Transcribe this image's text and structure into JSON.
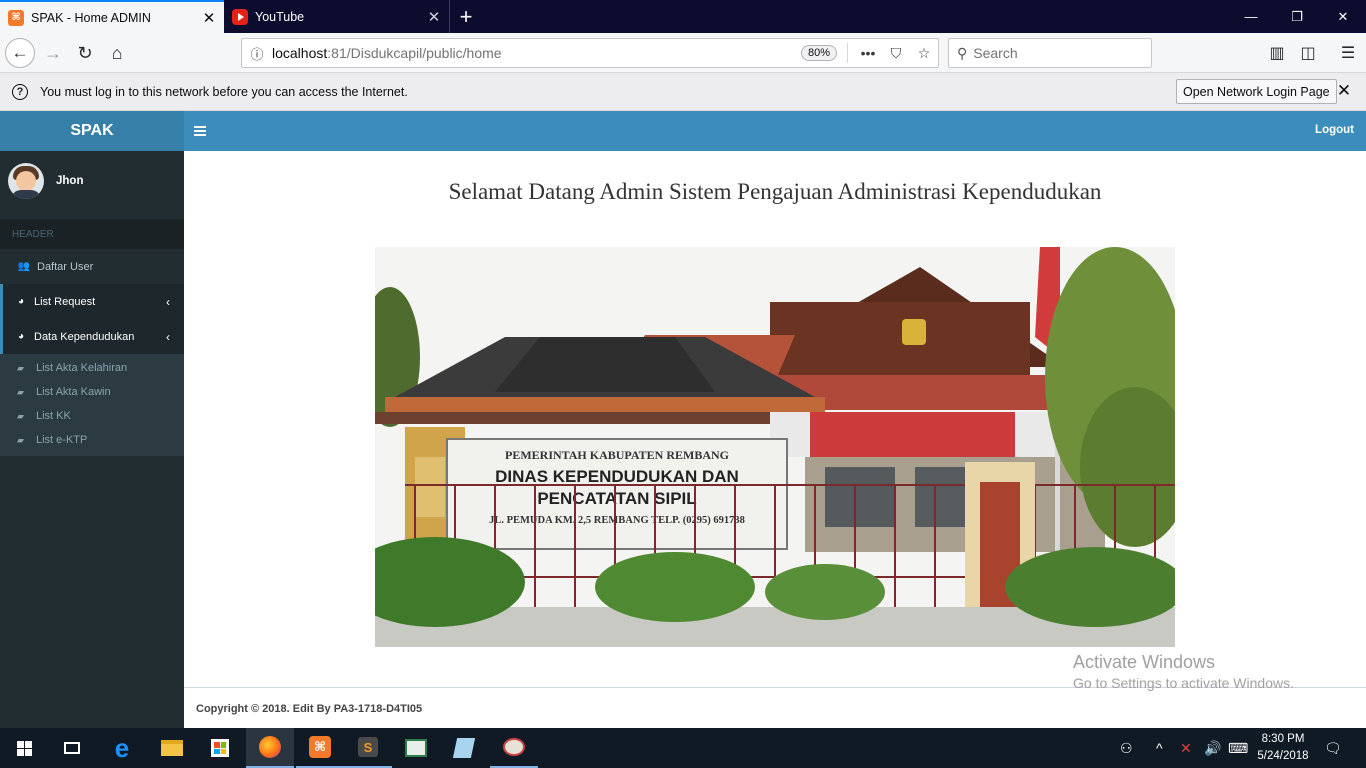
{
  "browser": {
    "tabs": [
      {
        "title": "SPAK - Home ADMIN",
        "active": true
      },
      {
        "title": "YouTube",
        "active": false
      }
    ],
    "url_host": "localhost",
    "url_rest": ":81/Disdukcapil/public/home",
    "zoom": "80%",
    "search_placeholder": "Search"
  },
  "notification": {
    "message": "You must log in to this network before you can access the Internet.",
    "button": "Open Network Login Page"
  },
  "app": {
    "logo": "SPAK",
    "logout": "Logout",
    "user_name": "Jhon",
    "sidebar_header": "HEADER",
    "menu": [
      {
        "label": "Daftar User",
        "icon": "users-icon"
      },
      {
        "label": "List Request",
        "icon": "dashboard-icon"
      },
      {
        "label": "Data Kependudukan",
        "icon": "dashboard-icon"
      }
    ],
    "submenu": [
      "List Akta Kelahiran",
      "List Akta Kawin",
      "List KK",
      "List e-KTP"
    ]
  },
  "content": {
    "welcome": "Selamat Datang Admin Sistem Pengajuan Administrasi Kependudukan",
    "sign_line1": "PEMERINTAH KABUPATEN REMBANG",
    "sign_line2": "DINAS KEPENDUDUKAN DAN",
    "sign_line3": "PENCATATAN SIPIL",
    "sign_line4": "JL. PEMUDA KM. 2,5 REMBANG TELP. (0295) 691738"
  },
  "footer": {
    "copyright": "Copyright © 2018. Edit By PA3-1718-D4TI05"
  },
  "watermark": {
    "line1": "Activate Windows",
    "line2": "Go to Settings to activate Windows."
  },
  "taskbar": {
    "time": "8:30 PM",
    "date": "5/24/2018"
  },
  "colors": {
    "header": "#3c8dbc",
    "logo": "#367fa9",
    "sidebar": "#222d32"
  }
}
